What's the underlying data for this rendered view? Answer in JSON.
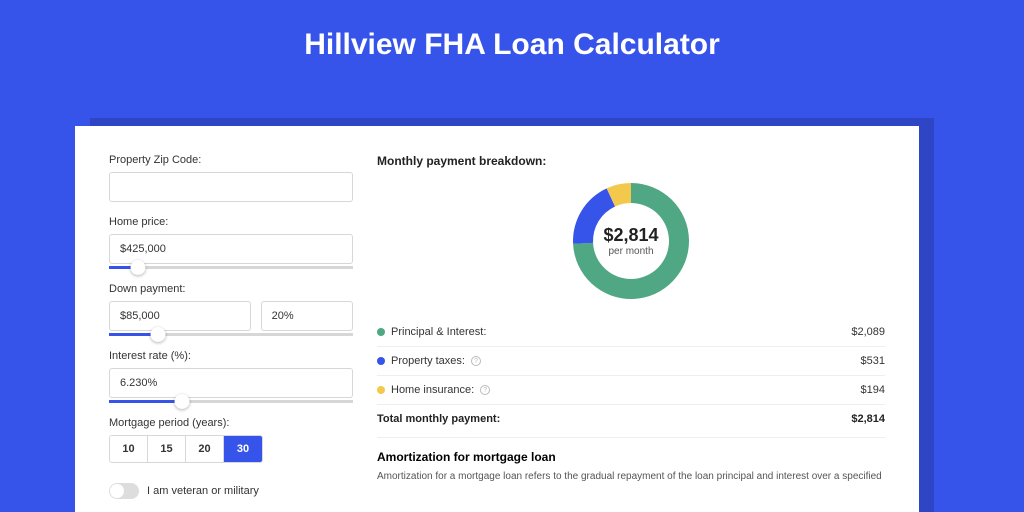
{
  "page_title": "Hillview FHA Loan Calculator",
  "form": {
    "zip_label": "Property Zip Code:",
    "zip_value": "",
    "home_price_label": "Home price:",
    "home_price_value": "$425,000",
    "home_price_slider_pct": 12,
    "down_payment_label": "Down payment:",
    "down_payment_value": "$85,000",
    "down_payment_pct_value": "20%",
    "down_payment_slider_pct": 20,
    "interest_label": "Interest rate (%):",
    "interest_value": "6.230%",
    "interest_slider_pct": 30,
    "period_label": "Mortgage period (years):",
    "periods": [
      "10",
      "15",
      "20",
      "30"
    ],
    "period_selected": "30",
    "veteran_label": "I am veteran or military"
  },
  "breakdown": {
    "heading": "Monthly payment breakdown:",
    "total_display": "$2,814",
    "total_sub": "per month",
    "items": [
      {
        "label": "Principal & Interest:",
        "value": "$2,089",
        "color": "#4fa783"
      },
      {
        "label": "Property taxes:",
        "value": "$531",
        "color": "#3754ea",
        "info": true
      },
      {
        "label": "Home insurance:",
        "value": "$194",
        "color": "#f2c94c",
        "info": true
      }
    ],
    "total_label": "Total monthly payment:",
    "total_value": "$2,814"
  },
  "amortization": {
    "heading": "Amortization for mortgage loan",
    "text": "Amortization for a mortgage loan refers to the gradual repayment of the loan principal and interest over a specified"
  },
  "chart_data": {
    "type": "pie",
    "title": "Monthly payment breakdown",
    "series": [
      {
        "name": "Principal & Interest",
        "value": 2089,
        "color": "#4fa783"
      },
      {
        "name": "Property taxes",
        "value": 531,
        "color": "#3754ea"
      },
      {
        "name": "Home insurance",
        "value": 194,
        "color": "#f2c94c"
      }
    ],
    "total": 2814,
    "donut": true,
    "center_label": "$2,814 per month"
  }
}
